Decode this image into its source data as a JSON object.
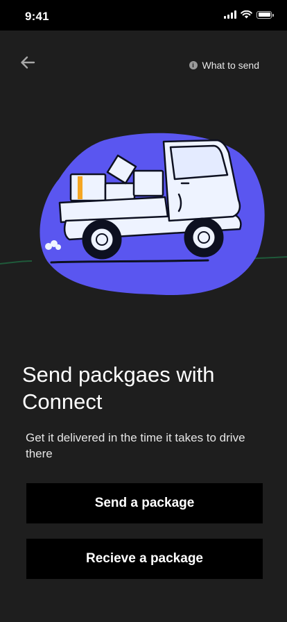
{
  "status_bar": {
    "time": "9:41",
    "icons": [
      "cellular-signal-icon",
      "wifi-icon",
      "battery-icon"
    ]
  },
  "header": {
    "back_icon": "arrow-left-icon",
    "info_icon": "info-icon",
    "info_label": "What to send"
  },
  "illustration": {
    "subject": "delivery-truck-illustration",
    "colors": {
      "blob": "#5a56f0",
      "truck": "#eef3ff",
      "outline": "#0d1020",
      "accent": "#f5a623"
    }
  },
  "content": {
    "headline": "Send packgaes with Connect",
    "subtext": "Get it delivered in the time it takes to drive there"
  },
  "actions": {
    "send_label": "Send a package",
    "receive_label": "Recieve a package"
  },
  "colors": {
    "background": "#1e1e1e",
    "button_background": "#000000",
    "text": "#ffffff"
  }
}
